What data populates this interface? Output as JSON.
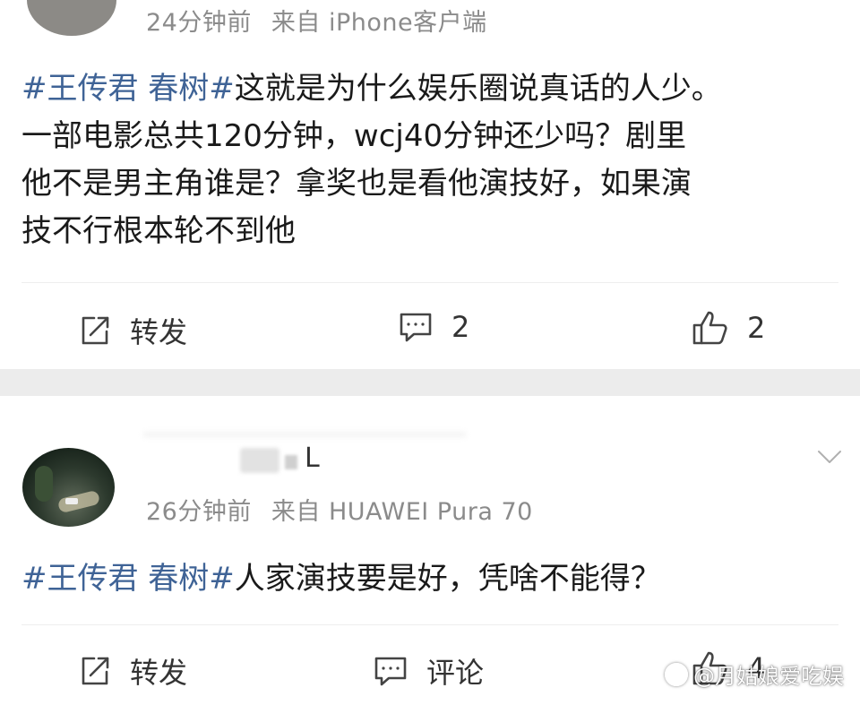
{
  "posts": [
    {
      "time": "24分钟前",
      "source": "来自 iPhone客户端",
      "tag": "#王传君 春树#",
      "lines": [
        "这就是为什么娱乐圈说真话的人少。",
        "一部电影总共120分钟，wcj40分钟还少吗？剧里",
        "他不是男主角谁是？拿奖也是看他演技好，如果演",
        "技不行根本轮不到他"
      ],
      "actions": {
        "repost": "转发",
        "comments": "2",
        "likes": "2"
      }
    },
    {
      "name_tail": "L",
      "time": "26分钟前",
      "source": "来自 HUAWEI Pura 70",
      "tag": "#王传君 春树#",
      "lines": [
        "人家演技要是好，凭啥不能得？"
      ],
      "actions": {
        "repost": "转发",
        "comments": "评论",
        "likes": "4"
      }
    }
  ],
  "watermark": "@月姑娘爱吃娱",
  "icons": {
    "repost": "repost-icon",
    "comment": "comment-icon",
    "like": "thumbs-up-icon",
    "more": "chevron-down-icon"
  },
  "colors": {
    "tag": "#3f6396",
    "meta": "#8b8b8b",
    "separator": "#ececec"
  }
}
